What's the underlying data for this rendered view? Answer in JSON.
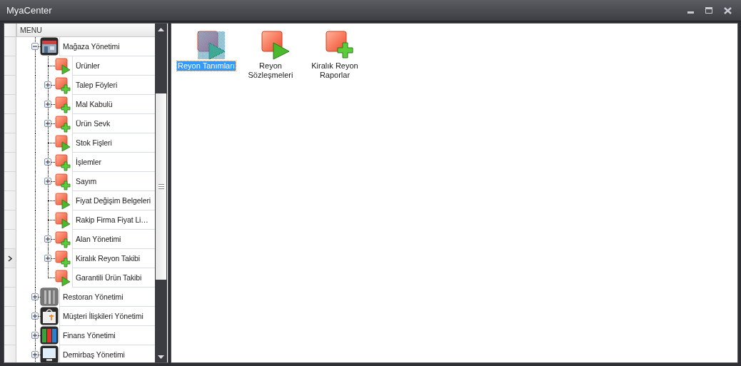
{
  "window": {
    "title": "MyaCenter"
  },
  "tree": {
    "header": "MENU",
    "items": [
      {
        "label": "Mağaza Yönetimi",
        "kind": "store",
        "expanded": true,
        "current": false,
        "children": [
          {
            "label": "Ürünler",
            "kind": "play",
            "current": false
          },
          {
            "label": "Talep Föyleri",
            "kind": "plus",
            "expanded": false,
            "current": false
          },
          {
            "label": "Mal Kabulü",
            "kind": "plus",
            "expanded": false,
            "current": false
          },
          {
            "label": "Ürün Sevk",
            "kind": "plus",
            "expanded": false,
            "current": false
          },
          {
            "label": "Stok Fişleri",
            "kind": "play",
            "current": false
          },
          {
            "label": "İşlemler",
            "kind": "plus",
            "expanded": false,
            "current": false
          },
          {
            "label": "Sayım",
            "kind": "plus",
            "expanded": false,
            "current": false
          },
          {
            "label": "Fiyat Değişim Belgeleri",
            "kind": "play",
            "current": false
          },
          {
            "label": "Rakip Firma Fiyat Li…",
            "kind": "play",
            "current": false
          },
          {
            "label": "Alan Yönetimi",
            "kind": "plus",
            "expanded": false,
            "current": false
          },
          {
            "label": "Kiralık Reyon Takibi",
            "kind": "plus",
            "expanded": false,
            "current": true
          },
          {
            "label": "Garantili Ürün Takibi",
            "kind": "play",
            "current": false
          }
        ]
      },
      {
        "label": "Restoran Yönetimi",
        "kind": "restaurant",
        "expanded": false,
        "current": false
      },
      {
        "label": "Müşteri İlişkileri Yönetimi",
        "kind": "crm",
        "expanded": false,
        "current": false
      },
      {
        "label": "Finans Yönetimi",
        "kind": "finance",
        "expanded": false,
        "current": false
      },
      {
        "label": "Demirbaş Yönetimi",
        "kind": "assets",
        "expanded": false,
        "current": false
      }
    ]
  },
  "tiles": [
    {
      "label": "Reyon Tanımları",
      "kind": "play",
      "selected": true
    },
    {
      "label": "Reyon Sözleşmeleri",
      "kind": "play",
      "selected": false
    },
    {
      "label": "Kiralık Reyon Raporlar",
      "kind": "plus",
      "selected": false
    }
  ]
}
